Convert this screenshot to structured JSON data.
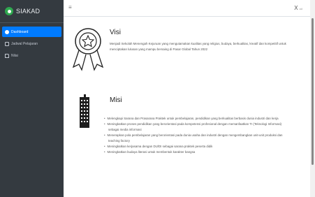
{
  "brand": {
    "name": "SIAKAD",
    "color": "#2fa84f"
  },
  "topbar": {
    "menu_glyph": "≡",
    "user_label": "X",
    "user_sub": "ad"
  },
  "sidebar": {
    "items": [
      {
        "label": "Dashboard",
        "icon": "dashboard-icon",
        "active": true
      },
      {
        "label": "Jadwal Pelajaran",
        "icon": "document-icon",
        "active": false
      },
      {
        "label": "Nilai",
        "icon": "file-icon",
        "active": false
      }
    ]
  },
  "visi": {
    "title": "Visi",
    "text_line1": "Menjadi Sekolah Menengah Kejuruan yang mengutamakan kualitas yang religius, budaya, berkualitas, kreatif dan kompetitif untuk",
    "text_line2": "menciptakan lulusan yang mampu bersaing di Pasar Global Tahun 2022"
  },
  "misi": {
    "title": "Misi",
    "items": [
      "Melengkapi Sarana dan Prasarana Praktek untuk pembelajaran, pendidikan yang berkualitas berbasis dunia industri dan kerja",
      "Meningkatkan proses pendidikan yang berorientasi pada kompetensi profesional dengan memanfaatkan TI (Teknologi Informasi)",
      "sebagai media informasi",
      "Menerapkan pola pembelajaran yang berorientasi pada dunia usaha dan industri dengan mengembangkan unit-unit produksi dan",
      "teaching factory",
      "Meningkatkan kerjasama dengan DU/DI sebagai sarana praktek peserta didik",
      "Meningkatkan budaya literasi untuk membentuk karakter bangsa"
    ]
  },
  "colors": {
    "sidebar_bg": "#343a40",
    "active_item": "#007bff"
  }
}
